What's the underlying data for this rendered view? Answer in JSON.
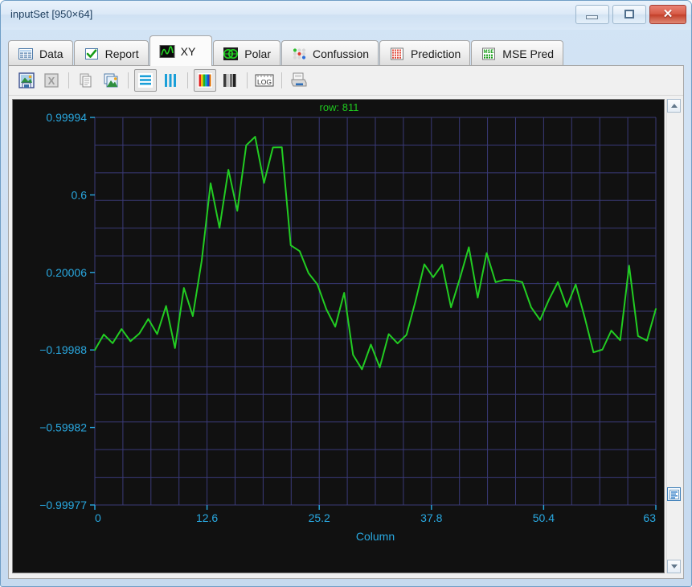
{
  "window": {
    "title": "inputSet [950×64]",
    "buttons": {
      "minimize": "Minimize",
      "maximize": "Maximize",
      "close": "✕"
    }
  },
  "tabs": [
    {
      "label": "Data",
      "icon": "table-icon",
      "active": false
    },
    {
      "label": "Report",
      "icon": "checkmark-icon",
      "active": false
    },
    {
      "label": "XY",
      "icon": "waveform-icon",
      "active": true
    },
    {
      "label": "Polar",
      "icon": "polar-icon",
      "active": false
    },
    {
      "label": "Confussion",
      "icon": "dots-grid-icon",
      "active": false
    },
    {
      "label": "Prediction",
      "icon": "grid-red-icon",
      "active": false
    },
    {
      "label": "MSE Pred",
      "icon": "mse-grid-icon",
      "active": false
    }
  ],
  "toolbar": {
    "items": [
      {
        "name": "save-image-button",
        "icon": "save-picture-icon",
        "enabled": true,
        "pressed": false,
        "label": "Save image"
      },
      {
        "name": "export-excel-button",
        "icon": "excel-icon",
        "enabled": false,
        "pressed": false,
        "label": "Export to Excel"
      },
      {
        "name": "copy-button",
        "icon": "copy-pages-icon",
        "enabled": false,
        "pressed": false,
        "label": "Copy"
      },
      {
        "name": "copy-image-button",
        "icon": "copy-image-icon",
        "enabled": true,
        "pressed": false,
        "label": "Copy image"
      },
      {
        "name": "rows-view-button",
        "icon": "horizontal-bars-icon",
        "enabled": true,
        "pressed": true,
        "label": "Rows"
      },
      {
        "name": "columns-view-button",
        "icon": "vertical-bars-icon",
        "enabled": true,
        "pressed": false,
        "label": "Columns"
      },
      {
        "name": "color-mode-button",
        "icon": "color-bars-icon",
        "enabled": true,
        "pressed": true,
        "label": "Color"
      },
      {
        "name": "gray-mode-button",
        "icon": "gray-bars-icon",
        "enabled": true,
        "pressed": false,
        "label": "Grayscale"
      },
      {
        "name": "log-scale-button",
        "icon": "log-icon",
        "enabled": true,
        "pressed": false,
        "label": "LOG"
      },
      {
        "name": "print-button",
        "icon": "printer-icon",
        "enabled": true,
        "pressed": false,
        "label": "Print"
      }
    ]
  },
  "scrollbar": {
    "up_arrow": "▲",
    "down_arrow": "▼",
    "thumb_icon": "list-lines-icon"
  },
  "colors": {
    "plot_background": "#111111",
    "grid": "#3a3a78",
    "axis_text": "#29a8e0",
    "series": "#22cc22",
    "title_text": "#1fc81f",
    "window_accent": "#cfe1f3"
  },
  "chart_data": {
    "type": "line",
    "title": "row: 811",
    "xlabel": "Column",
    "ylabel": "",
    "grid": true,
    "legend": "none",
    "xlim": [
      0,
      63
    ],
    "ylim": [
      -0.99977,
      0.99994
    ],
    "xticks": [
      0,
      12.6,
      25.2,
      37.8,
      50.4,
      63
    ],
    "xticklabels": [
      "0",
      "12.6",
      "25.2",
      "37.8",
      "50.4",
      "63"
    ],
    "yticks": [
      -0.99977,
      -0.59982,
      -0.19988,
      0.20006,
      0.6,
      0.99994
    ],
    "yticklabels": [
      "-0.99977",
      "-0.59982",
      "-0.19988",
      "0.20006",
      "0.6",
      "0.99994"
    ],
    "x": [
      0,
      1,
      2,
      3,
      4,
      5,
      6,
      7,
      8,
      9,
      10,
      11,
      12,
      13,
      14,
      15,
      16,
      17,
      18,
      19,
      20,
      21,
      22,
      23,
      24,
      25,
      26,
      27,
      28,
      29,
      30,
      31,
      32,
      33,
      34,
      35,
      36,
      37,
      38,
      39,
      40,
      41,
      42,
      43,
      44,
      45,
      46,
      47,
      48,
      49,
      50,
      51,
      52,
      53,
      54,
      55,
      56,
      57,
      58,
      59,
      60,
      61,
      62,
      63
    ],
    "series": [
      {
        "name": "row 811",
        "color": "#22cc22",
        "values": [
          -0.2,
          -0.12,
          -0.165,
          -0.092,
          -0.155,
          -0.115,
          -0.04,
          -0.118,
          0.027,
          -0.19,
          0.12,
          -0.025,
          0.26,
          0.66,
          0.43,
          0.73,
          0.518,
          0.856,
          0.9,
          0.662,
          0.845,
          0.846,
          0.34,
          0.31,
          0.196,
          0.138,
          0.01,
          -0.08,
          0.095,
          -0.225,
          -0.3,
          -0.172,
          -0.29,
          -0.118,
          -0.166,
          -0.122,
          0.05,
          0.242,
          0.175,
          0.24,
          0.02,
          0.17,
          0.33,
          0.07,
          0.3,
          0.15,
          0.162,
          0.16,
          0.15,
          0.02,
          -0.045,
          0.06,
          0.15,
          0.022,
          0.138,
          -0.03,
          -0.212,
          -0.198,
          -0.1,
          -0.15,
          0.235,
          -0.128,
          -0.152,
          0.012
        ]
      }
    ]
  }
}
